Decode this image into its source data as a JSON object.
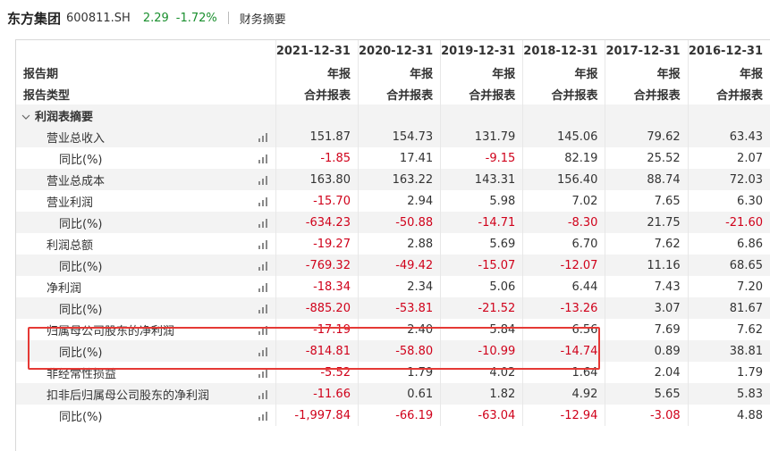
{
  "stock": {
    "name": "东方集团",
    "code": "600811.SH",
    "price": "2.29",
    "change_pct": "-1.72%",
    "section": "财务摘要"
  },
  "columns": [
    "2021-12-31",
    "2020-12-31",
    "2019-12-31",
    "2018-12-31",
    "2017-12-31",
    "2016-12-31"
  ],
  "header_rows": [
    {
      "label": "报告期",
      "values": [
        "年报",
        "年报",
        "年报",
        "年报",
        "年报",
        "年报"
      ]
    },
    {
      "label": "报告类型",
      "values": [
        "合并报表",
        "合并报表",
        "合并报表",
        "合并报表",
        "合并报表",
        "合并报表"
      ]
    }
  ],
  "section_title": "利润表摘要",
  "rows": [
    {
      "label": "营业总收入",
      "level": 1,
      "values": [
        "151.87",
        "154.73",
        "131.79",
        "145.06",
        "79.62",
        "63.43"
      ]
    },
    {
      "label": "同比(%)",
      "level": 2,
      "values": [
        "-1.85",
        "17.41",
        "-9.15",
        "82.19",
        "25.52",
        "2.07"
      ]
    },
    {
      "label": "营业总成本",
      "level": 1,
      "values": [
        "163.80",
        "163.22",
        "143.31",
        "156.40",
        "88.74",
        "72.03"
      ]
    },
    {
      "label": "营业利润",
      "level": 1,
      "values": [
        "-15.70",
        "2.94",
        "5.98",
        "7.02",
        "7.65",
        "6.30"
      ]
    },
    {
      "label": "同比(%)",
      "level": 2,
      "values": [
        "-634.23",
        "-50.88",
        "-14.71",
        "-8.30",
        "21.75",
        "-21.60"
      ]
    },
    {
      "label": "利润总额",
      "level": 1,
      "values": [
        "-19.27",
        "2.88",
        "5.69",
        "6.70",
        "7.62",
        "6.86"
      ]
    },
    {
      "label": "同比(%)",
      "level": 2,
      "values": [
        "-769.32",
        "-49.42",
        "-15.07",
        "-12.07",
        "11.16",
        "68.65"
      ]
    },
    {
      "label": "净利润",
      "level": 1,
      "values": [
        "-18.34",
        "2.34",
        "5.06",
        "6.44",
        "7.43",
        "7.20"
      ]
    },
    {
      "label": "同比(%)",
      "level": 2,
      "values": [
        "-885.20",
        "-53.81",
        "-21.52",
        "-13.26",
        "3.07",
        "81.67"
      ]
    },
    {
      "label": "归属母公司股东的净利润",
      "level": 1,
      "values": [
        "-17.19",
        "2.40",
        "5.84",
        "6.56",
        "7.69",
        "7.62"
      ]
    },
    {
      "label": "同比(%)",
      "level": 2,
      "values": [
        "-814.81",
        "-58.80",
        "-10.99",
        "-14.74",
        "0.89",
        "38.81"
      ]
    },
    {
      "label": "非经常性损益",
      "level": 1,
      "values": [
        "-5.52",
        "1.79",
        "4.02",
        "1.64",
        "2.04",
        "1.79"
      ]
    },
    {
      "label": "扣非后归属母公司股东的净利润",
      "level": 1,
      "values": [
        "-11.66",
        "0.61",
        "1.82",
        "4.92",
        "5.65",
        "5.83"
      ]
    },
    {
      "label": "同比(%)",
      "level": 2,
      "values": [
        "-1,997.84",
        "-66.19",
        "-63.04",
        "-12.94",
        "-3.08",
        "4.88"
      ]
    }
  ],
  "colors": {
    "negative": "#d0021b",
    "positive_quote": "#1a8f2e",
    "highlight": "#e53935"
  },
  "icons": {
    "chart": "bar-chart-icon",
    "collapse": "chevron-down-icon"
  }
}
